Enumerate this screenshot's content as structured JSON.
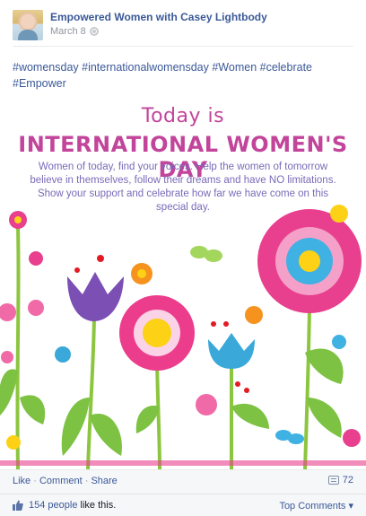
{
  "post": {
    "page_name": "Empowered Women with Casey Lightbody",
    "date": "March 8",
    "privacy_icon": "globe-icon",
    "hashtags": "#womensday #internationalwomensday #Women #celebrate #Empower",
    "image": {
      "title_line1": "Today is",
      "title_line2": "INTERNATIONAL WOMEN'S DAY",
      "paragraph": "Women of today, find your voices. Help the women of tomorrow believe in themselves, follow their dreams and have NO limitations. Show your support and celebrate how far we have come on this special day."
    }
  },
  "footer": {
    "like": "Like",
    "comment": "Comment",
    "share": "Share",
    "separator": " · ",
    "comment_count": "72",
    "likes_count_text": "154 people",
    "likes_suffix": " like this.",
    "top_comments": "Top Comments ▾"
  },
  "colors": {
    "link": "#3b5998",
    "title_pink": "#c2449b",
    "paragraph_purple": "#7a6ab8"
  }
}
